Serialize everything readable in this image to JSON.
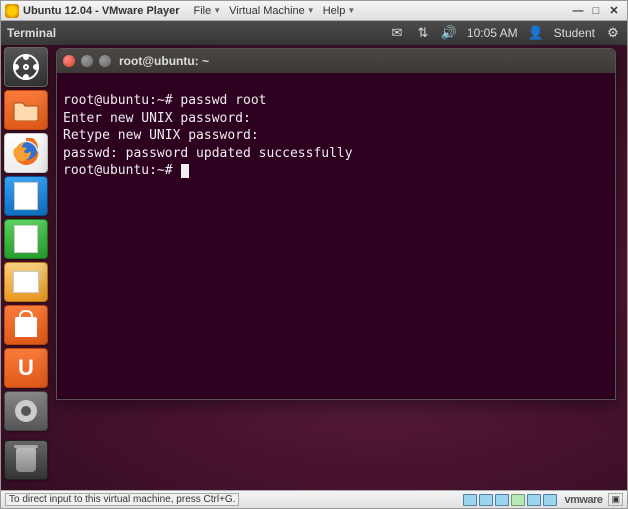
{
  "vmware": {
    "title": "Ubuntu 12.04 - VMware Player",
    "menus": [
      "File",
      "Virtual Machine",
      "Help"
    ],
    "statusHint": "To direct input to this virtual machine, press Ctrl+G.",
    "brand": "vmware"
  },
  "ubuntu": {
    "panelApp": "Terminal",
    "time": "10:05 AM",
    "user": "Student"
  },
  "launcher": {
    "items": [
      {
        "name": "dash"
      },
      {
        "name": "files"
      },
      {
        "name": "firefox"
      },
      {
        "name": "writer"
      },
      {
        "name": "calc"
      },
      {
        "name": "impress"
      },
      {
        "name": "software"
      },
      {
        "name": "ubuntu-one"
      },
      {
        "name": "settings"
      },
      {
        "name": "trash"
      }
    ]
  },
  "terminal": {
    "title": "root@ubuntu: ~",
    "prompt": "root@ubuntu:~#",
    "lines": [
      "root@ubuntu:~# passwd root",
      "Enter new UNIX password:",
      "Retype new UNIX password:",
      "passwd: password updated successfully",
      "root@ubuntu:~#"
    ]
  }
}
